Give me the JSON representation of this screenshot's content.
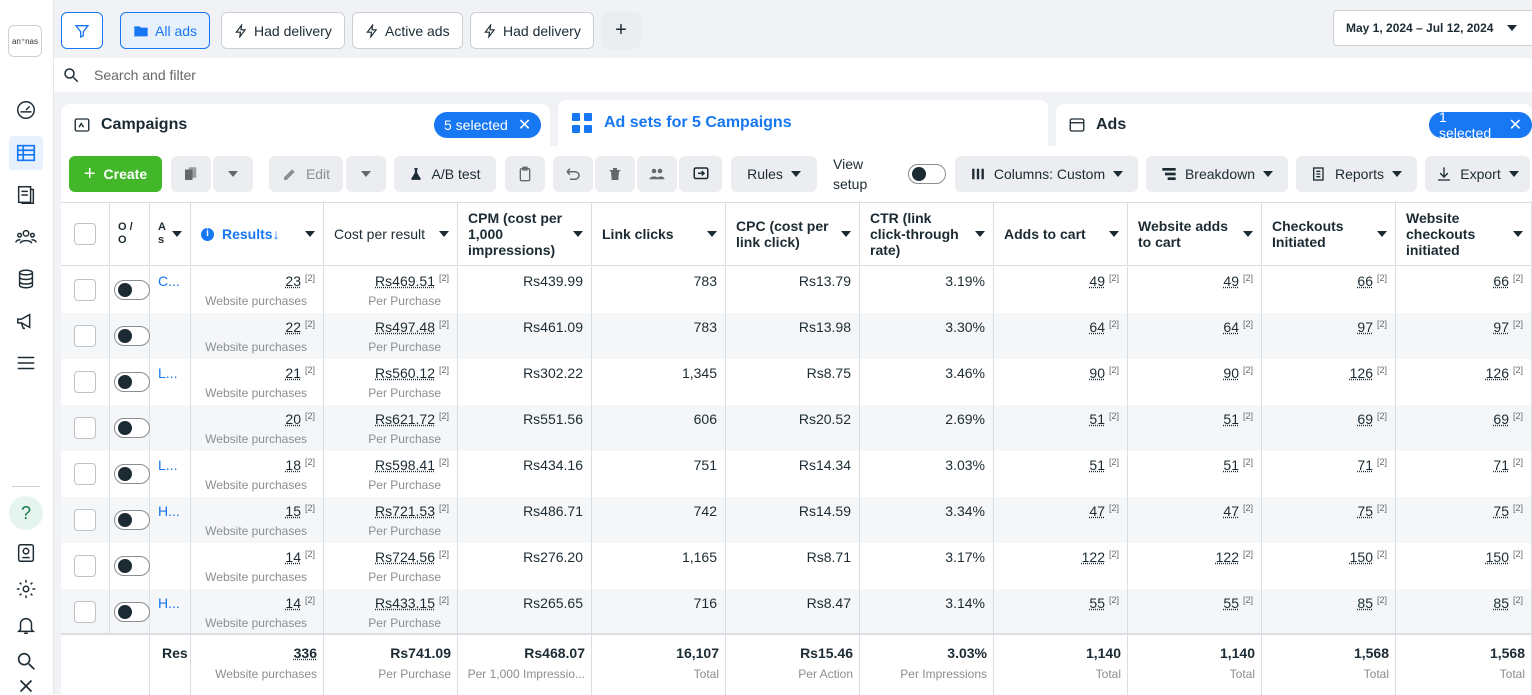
{
  "brand": {
    "logo_text": "an⁺nas"
  },
  "rail": {
    "icons": [
      "dashboard-icon",
      "table-icon",
      "document-icon",
      "people-icon",
      "database-icon",
      "megaphone-icon",
      "menu-icon",
      "help-icon",
      "profile-icon",
      "gear-icon",
      "bell-icon",
      "search-icon",
      "close-icon"
    ]
  },
  "topbar": {
    "filter_tabs": [
      "All ads",
      "Had delivery",
      "Active ads",
      "Had delivery"
    ],
    "date_range": "May 1, 2024 – Jul 12, 2024"
  },
  "search": {
    "placeholder": "Search and filter"
  },
  "panes": {
    "campaigns": {
      "title": "Campaigns",
      "chip": "5 selected"
    },
    "adsets": {
      "title": "Ad sets for 5 Campaigns"
    },
    "ads": {
      "title": "Ads",
      "chip": "1 selected"
    }
  },
  "toolbar": {
    "create": "Create",
    "edit": "Edit",
    "ab_test": "A/B test",
    "rules": "Rules",
    "view_setup": "View setup",
    "columns": "Columns: Custom",
    "breakdown": "Breakdown",
    "reports": "Reports",
    "export": "Export"
  },
  "columns": {
    "off_on": "O / O",
    "adset": "A s",
    "results": "Results",
    "cost_per_result": "Cost per result",
    "cpm": "CPM (cost per 1,000 impressions)",
    "link_clicks": "Link clicks",
    "cpc": "CPC (cost per link click)",
    "ctr": "CTR (link click-through rate)",
    "adds_to_cart": "Adds to cart",
    "website_adds": "Website adds to cart",
    "checkouts": "Checkouts Initiated",
    "website_checkouts": "Website checkouts initiated"
  },
  "footnote_mark": "[2]",
  "rows": [
    {
      "name": "C...",
      "results": "23",
      "results_sub": "Website purchases",
      "cpr": "Rs469.51",
      "cpr_sub": "Per Purchase",
      "cpm": "Rs439.99",
      "clicks": "783",
      "cpc": "Rs13.79",
      "ctr": "3.19%",
      "atc": "49",
      "watc": "49",
      "ci": "66",
      "wci": "66"
    },
    {
      "name": "",
      "results": "22",
      "results_sub": "Website purchases",
      "cpr": "Rs497.48",
      "cpr_sub": "Per Purchase",
      "cpm": "Rs461.09",
      "clicks": "783",
      "cpc": "Rs13.98",
      "ctr": "3.30%",
      "atc": "64",
      "watc": "64",
      "ci": "97",
      "wci": "97"
    },
    {
      "name": "L...",
      "results": "21",
      "results_sub": "Website purchases",
      "cpr": "Rs560.12",
      "cpr_sub": "Per Purchase",
      "cpm": "Rs302.22",
      "clicks": "1,345",
      "cpc": "Rs8.75",
      "ctr": "3.46%",
      "atc": "90",
      "watc": "90",
      "ci": "126",
      "wci": "126"
    },
    {
      "name": "",
      "results": "20",
      "results_sub": "Website purchases",
      "cpr": "Rs621.72",
      "cpr_sub": "Per Purchase",
      "cpm": "Rs551.56",
      "clicks": "606",
      "cpc": "Rs20.52",
      "ctr": "2.69%",
      "atc": "51",
      "watc": "51",
      "ci": "69",
      "wci": "69"
    },
    {
      "name": "L...",
      "results": "18",
      "results_sub": "Website purchases",
      "cpr": "Rs598.41",
      "cpr_sub": "Per Purchase",
      "cpm": "Rs434.16",
      "clicks": "751",
      "cpc": "Rs14.34",
      "ctr": "3.03%",
      "atc": "51",
      "watc": "51",
      "ci": "71",
      "wci": "71"
    },
    {
      "name": "H...",
      "results": "15",
      "results_sub": "Website purchases",
      "cpr": "Rs721.53",
      "cpr_sub": "Per Purchase",
      "cpm": "Rs486.71",
      "clicks": "742",
      "cpc": "Rs14.59",
      "ctr": "3.34%",
      "atc": "47",
      "watc": "47",
      "ci": "75",
      "wci": "75"
    },
    {
      "name": "",
      "results": "14",
      "results_sub": "Website purchases",
      "cpr": "Rs724.56",
      "cpr_sub": "Per Purchase",
      "cpm": "Rs276.20",
      "clicks": "1,165",
      "cpc": "Rs8.71",
      "ctr": "3.17%",
      "atc": "122",
      "watc": "122",
      "ci": "150",
      "wci": "150"
    },
    {
      "name": "H...",
      "results": "14",
      "results_sub": "Website purchases",
      "cpr": "Rs433.15",
      "cpr_sub": "Per Purchase",
      "cpm": "Rs265.65",
      "clicks": "716",
      "cpc": "Rs8.47",
      "ctr": "3.14%",
      "atc": "55",
      "watc": "55",
      "ci": "85",
      "wci": "85"
    }
  ],
  "totals": {
    "label": "Res",
    "results": "336",
    "results_sub": "Website purchases",
    "cpr": "Rs741.09",
    "cpr_sub": "Per Purchase",
    "cpm": "Rs468.07",
    "cpm_sub": "Per 1,000 Impressio...",
    "clicks": "16,107",
    "clicks_sub": "Total",
    "cpc": "Rs15.46",
    "cpc_sub": "Per Action",
    "ctr": "3.03%",
    "ctr_sub": "Per Impressions",
    "atc": "1,140",
    "atc_sub": "Total",
    "watc": "1,140",
    "watc_sub": "Total",
    "ci": "1,568",
    "ci_sub": "Total",
    "wci": "1,568",
    "wci_sub": "Total"
  },
  "colors": {
    "accent": "#1877f2",
    "create": "#42b72a"
  }
}
